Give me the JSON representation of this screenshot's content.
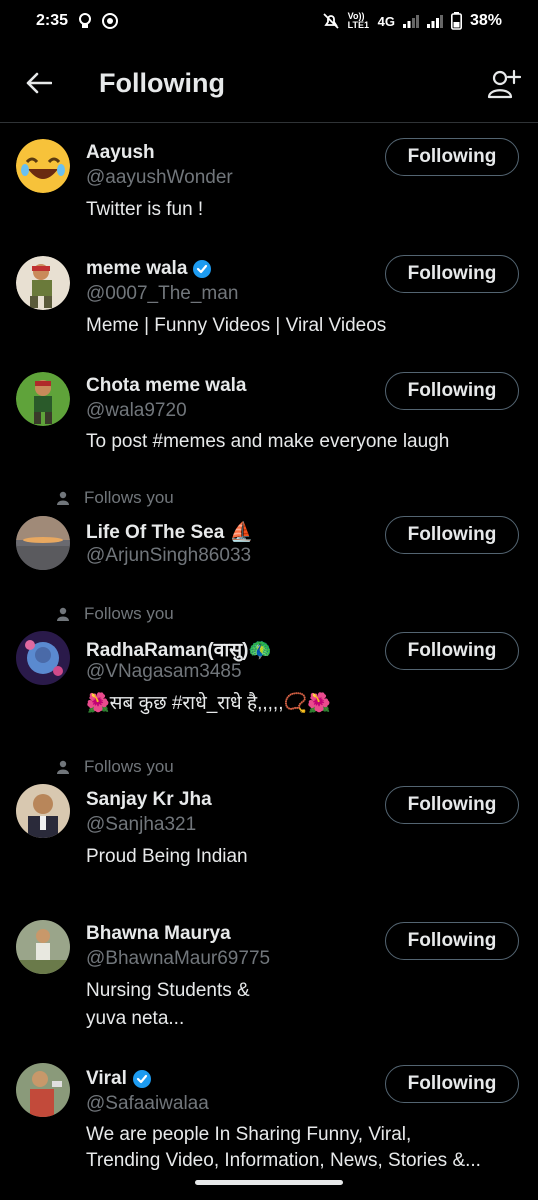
{
  "status_bar": {
    "time": "2:35",
    "network": "4G",
    "volte": "Vo)) LTE1",
    "battery": "38%"
  },
  "header": {
    "title": "Following",
    "back_icon": "arrow-left-icon",
    "add_icon": "add-user-icon"
  },
  "follows_you_label": "Follows you",
  "button_label": "Following",
  "users": [
    {
      "name": "Aayush",
      "handle": "@aayushWonder",
      "bio": "Twitter is fun !",
      "verified": false,
      "follows_you": false,
      "avatar_color": "#f5c33b"
    },
    {
      "name": "meme wala",
      "handle": "@0007_The_man",
      "bio": "Meme | Funny Videos | Viral Videos",
      "verified": true,
      "follows_you": false,
      "avatar_color": "#d9cfc0"
    },
    {
      "name": "Chota meme wala",
      "handle": "@wala9720",
      "bio": "To post #memes and make everyone laugh",
      "verified": false,
      "follows_you": false,
      "avatar_color": "#5fa33a"
    },
    {
      "name": "Life Of The Sea ⛵",
      "handle": "@ArjunSingh86033",
      "bio": "",
      "verified": false,
      "follows_you": true,
      "avatar_color": "#8a8a8a"
    },
    {
      "name": "RadhaRaman(वासु)🦚",
      "handle": "@VNagasam3485",
      "bio": "🌺सब कुछ #राधे_राधे है,,,,,📿🌺",
      "verified": false,
      "follows_you": true,
      "avatar_color": "#3a2a6a"
    },
    {
      "name": "Sanjay Kr Jha",
      "handle": "@Sanjha321",
      "bio": "Proud Being Indian",
      "verified": false,
      "follows_you": true,
      "avatar_color": "#b58b6a"
    },
    {
      "name": "Bhawna Maurya",
      "handle": "@BhawnaMaur69775",
      "bio": "Nursing Students &",
      "bio2": "yuva neta...",
      "verified": false,
      "follows_you": false,
      "avatar_color": "#9aa58a"
    },
    {
      "name": "Viral",
      "handle": "@Safaaiwalaa",
      "bio": "We are people In  Sharing Funny, Viral,",
      "bio2": "Trending Video, Information, News, Stories &...",
      "verified": true,
      "follows_you": false,
      "avatar_color": "#c24a3a"
    }
  ],
  "colors": {
    "background": "#000000",
    "text": "#e7e9ea",
    "secondary": "#71767b",
    "verified": "#1d9bf0",
    "button_border": "#536471"
  }
}
